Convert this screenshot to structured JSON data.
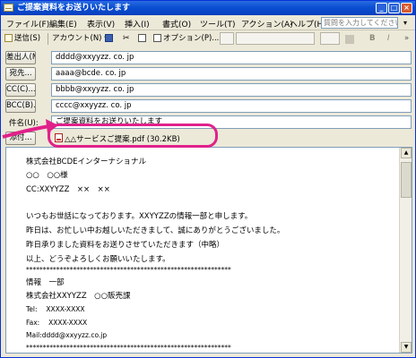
{
  "window": {
    "title": "ご提案資料をお送りいたします",
    "controls": {
      "minimize": "_",
      "maximize": "□",
      "close": "×"
    }
  },
  "menu": {
    "items": [
      "ファイル(F)",
      "編集(E)",
      "表示(V)",
      "挿入(I)",
      "書式(O)",
      "ツール(T)",
      "アクション(A)",
      "ヘルプ(H)"
    ],
    "help_placeholder": "質問を入力してください",
    "help_arrow": "▾"
  },
  "toolbar": {
    "send": "送信(S)",
    "account": "アカウント(N) ▾",
    "options": "オプション(P)...",
    "bold": "B",
    "italic": "I"
  },
  "fields": {
    "from_label": "差出人(M)...",
    "from_value": "dddd@xxyyzz. co. jp",
    "to_label": "宛先...",
    "to_value": "aaaa@bcde. co. jp",
    "cc_label": "CC(C)...",
    "cc_value": "bbbb@xxyyzz. co. jp",
    "bcc_label": "BCC(B)...",
    "bcc_value": "cccc@xxyyzz. co. jp",
    "subject_label": "件名(U):",
    "subject_value": "ご提案資料をお送りいたします",
    "attach_label": "添付...",
    "attachment": "△△サービスご提案.pdf (30.2KB)"
  },
  "body": {
    "lines": [
      "株式会社BCDEインターナショナル",
      "○○　○○様",
      "CC:XXYYZZ　××　××",
      "",
      "いつもお世話になっております。XXYYZZの情報一部と申します。",
      "昨日は、お忙しい中お越しいただきまして、誠にありがとうございました。",
      "昨日承りました資料をお送りさせていただきます（中略）",
      "以上、どうぞよろしくお願いいたします。",
      "*************************************************************",
      "情報　一部",
      "株式会社XXYYZZ　○○販売課",
      "Tel:　 XXXX-XXXX",
      "Fax:　 XXXX-XXXX",
      "Mail:dddd@xxyyzz.co.jp",
      "*************************************************************"
    ]
  },
  "annotation": {
    "color": "#e0218a"
  }
}
